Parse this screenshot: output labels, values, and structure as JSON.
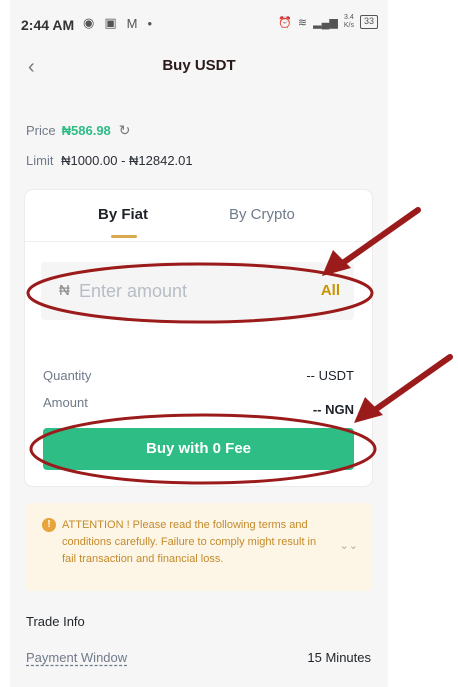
{
  "status_bar": {
    "time": "2:44 AM",
    "net_speed_top": "3.4",
    "net_speed_bottom": "K/s",
    "battery": "33"
  },
  "header": {
    "title": "Buy USDT"
  },
  "price": {
    "label": "Price",
    "value": "₦586.98"
  },
  "limit": {
    "label": "Limit",
    "value": "₦1000.00 - ₦12842.01"
  },
  "tabs": [
    {
      "label": "By Fiat"
    },
    {
      "label": "By Crypto"
    }
  ],
  "amount_input": {
    "currency_symbol": "₦",
    "placeholder": "Enter amount",
    "all_label": "All"
  },
  "details": {
    "quantity_label": "Quantity",
    "quantity_value": "-- USDT",
    "amount_label": "Amount",
    "amount_value": "-- NGN"
  },
  "buy_button": {
    "label": "Buy with 0 Fee"
  },
  "attention": {
    "text": "ATTENTION ! Please read the following terms and conditions carefully. Failure to comply might result in fail transaction and financial loss."
  },
  "trade_info": {
    "heading": "Trade Info",
    "payment_window_label": "Payment Window",
    "payment_window_value": "15 Minutes"
  },
  "colors": {
    "accent_green": "#2ebd85",
    "accent_gold": "#c99400",
    "annotation_red": "#9b1b1b"
  },
  "icons": [
    "back-icon",
    "refresh-icon",
    "warning-icon",
    "chevron-down-icon",
    "alarm-icon",
    "wifi-icon",
    "signal-icon",
    "battery-icon",
    "mail-icon"
  ]
}
